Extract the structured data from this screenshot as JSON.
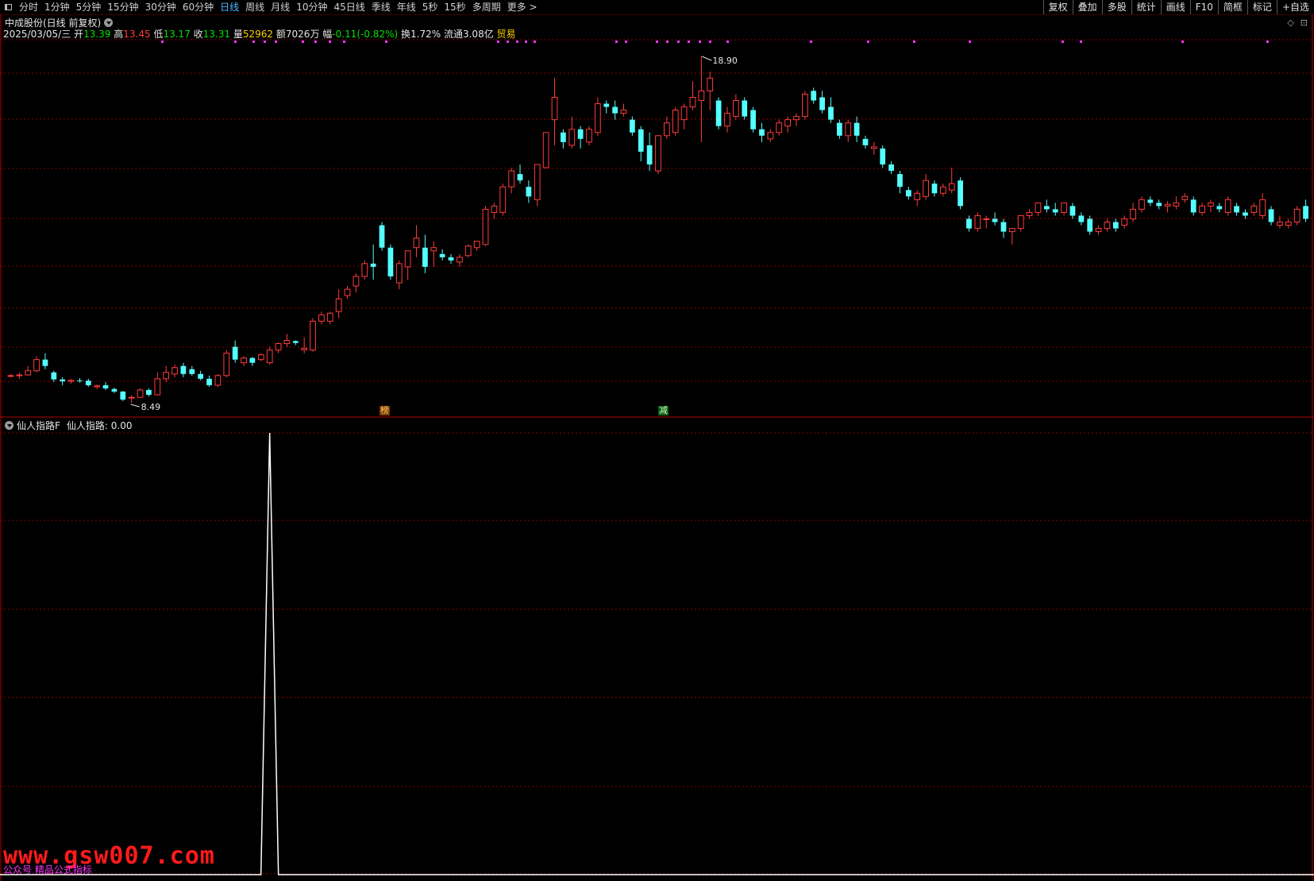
{
  "toolbar": {
    "tabs": [
      "分时",
      "1分钟",
      "5分钟",
      "15分钟",
      "30分钟",
      "60分钟",
      "日线",
      "周线",
      "月线",
      "10分钟",
      "45日线",
      "季线",
      "年线",
      "5秒",
      "15秒",
      "多周期",
      "更多 >"
    ],
    "active_tab": "日线",
    "right_tools": [
      "复权",
      "叠加",
      "多股",
      "统计",
      "画线",
      "F10",
      "简框",
      "标记",
      "+自选"
    ]
  },
  "header": {
    "title": "中成股份(日线 前复权)"
  },
  "quote": {
    "date": "2025/03/05/三",
    "open_label": "开",
    "open": "13.39",
    "high_label": "高",
    "high": "13.45",
    "low_label": "低",
    "low": "13.17",
    "close_label": "收",
    "close": "13.31",
    "vol_label": "量",
    "vol": "52962",
    "amt_label": "额",
    "amt": "7026万",
    "chg_label": "幅",
    "chg": "-0.11(-0.82%)",
    "turn_label": "换",
    "turn": "1.72%",
    "float_label": "流通",
    "float": "3.08亿",
    "sector": "贸易"
  },
  "colors": {
    "up": "#ff3b3b",
    "down": "#54ffff",
    "grid": "#8a0000",
    "marker": "#ff33ff",
    "accent": "#4db8ff"
  },
  "annotations": {
    "high_label": "18.90",
    "low_label": "8.49",
    "badge_1": "榜",
    "badge_2": "减"
  },
  "indicator": {
    "title": "仙人指路F",
    "value_label": "仙人指路: 0.00"
  },
  "watermark": {
    "text": "www.gsw007.com",
    "sub": "公众号 精品公式指标"
  },
  "chart_data": {
    "type": "candlestick",
    "ylim": [
      8.1,
      19.4
    ],
    "candles": [
      [
        8.9,
        8.95,
        8.85,
        8.9
      ],
      [
        8.9,
        9.0,
        8.8,
        8.92
      ],
      [
        8.92,
        9.2,
        8.9,
        9.05
      ],
      [
        9.05,
        9.5,
        9.0,
        9.4
      ],
      [
        9.4,
        9.6,
        9.1,
        9.2
      ],
      [
        9.0,
        9.05,
        8.7,
        8.78
      ],
      [
        8.78,
        8.85,
        8.6,
        8.72
      ],
      [
        8.72,
        8.8,
        8.65,
        8.75
      ],
      [
        8.75,
        8.82,
        8.68,
        8.74
      ],
      [
        8.74,
        8.8,
        8.55,
        8.6
      ],
      [
        8.55,
        8.62,
        8.48,
        8.58
      ],
      [
        8.6,
        8.7,
        8.45,
        8.5
      ],
      [
        8.48,
        8.52,
        8.35,
        8.4
      ],
      [
        8.4,
        8.42,
        8.1,
        8.15
      ],
      [
        8.2,
        8.28,
        8.05,
        8.22
      ],
      [
        8.22,
        8.5,
        8.2,
        8.45
      ],
      [
        8.45,
        8.5,
        8.25,
        8.3
      ],
      [
        8.3,
        9.0,
        8.28,
        8.8
      ],
      [
        8.8,
        9.2,
        8.7,
        9.0
      ],
      [
        8.95,
        9.25,
        8.85,
        9.15
      ],
      [
        9.2,
        9.3,
        8.85,
        8.95
      ],
      [
        9.1,
        9.2,
        8.9,
        8.95
      ],
      [
        8.95,
        9.05,
        8.75,
        8.8
      ],
      [
        8.8,
        8.9,
        8.55,
        8.6
      ],
      [
        8.6,
        8.95,
        8.55,
        8.9
      ],
      [
        8.9,
        9.7,
        8.85,
        9.6
      ],
      [
        9.8,
        10.0,
        9.3,
        9.4
      ],
      [
        9.3,
        9.5,
        9.2,
        9.45
      ],
      [
        9.45,
        9.48,
        9.2,
        9.3
      ],
      [
        9.4,
        9.6,
        9.35,
        9.55
      ],
      [
        9.3,
        9.8,
        9.25,
        9.7
      ],
      [
        9.7,
        9.95,
        9.6,
        9.9
      ],
      [
        9.9,
        10.2,
        9.8,
        10.0
      ],
      [
        9.98,
        10.0,
        9.85,
        9.92
      ],
      [
        9.7,
        10.1,
        9.6,
        9.75
      ],
      [
        9.7,
        10.7,
        9.65,
        10.6
      ],
      [
        10.6,
        10.9,
        10.5,
        10.8
      ],
      [
        10.6,
        10.9,
        10.5,
        10.85
      ],
      [
        10.9,
        11.6,
        10.7,
        11.3
      ],
      [
        11.4,
        11.7,
        11.3,
        11.6
      ],
      [
        11.7,
        12.1,
        11.5,
        12.0
      ],
      [
        12.0,
        12.5,
        11.9,
        12.4
      ],
      [
        12.4,
        13.0,
        11.9,
        12.3
      ],
      [
        13.6,
        13.7,
        12.8,
        12.9
      ],
      [
        12.9,
        13.0,
        11.9,
        12.0
      ],
      [
        11.8,
        12.5,
        11.6,
        12.4
      ],
      [
        12.3,
        12.8,
        11.9,
        12.8
      ],
      [
        12.9,
        13.6,
        12.6,
        13.2
      ],
      [
        12.9,
        13.3,
        12.1,
        12.3
      ],
      [
        12.8,
        13.1,
        12.3,
        12.9
      ],
      [
        12.7,
        12.85,
        12.5,
        12.6
      ],
      [
        12.6,
        12.7,
        12.4,
        12.5
      ],
      [
        12.45,
        12.7,
        12.3,
        12.6
      ],
      [
        12.65,
        13.0,
        12.6,
        12.95
      ],
      [
        12.9,
        13.1,
        12.8,
        13.1
      ],
      [
        13.0,
        14.2,
        12.95,
        14.1
      ],
      [
        14.0,
        14.3,
        13.8,
        14.2
      ],
      [
        14.0,
        14.9,
        13.9,
        14.8
      ],
      [
        14.8,
        15.4,
        14.6,
        15.3
      ],
      [
        15.2,
        15.5,
        14.9,
        15.0
      ],
      [
        14.8,
        15.0,
        14.3,
        14.5
      ],
      [
        14.4,
        15.5,
        14.2,
        15.5
      ],
      [
        15.4,
        16.5,
        15.4,
        16.5
      ],
      [
        16.9,
        18.2,
        16.1,
        17.6
      ],
      [
        16.5,
        16.6,
        16.0,
        16.2
      ],
      [
        16.1,
        17.0,
        16.0,
        16.6
      ],
      [
        16.6,
        16.7,
        16.0,
        16.3
      ],
      [
        16.2,
        16.7,
        16.1,
        16.6
      ],
      [
        16.5,
        17.6,
        16.4,
        17.4
      ],
      [
        17.4,
        17.5,
        17.1,
        17.3
      ],
      [
        17.3,
        17.5,
        16.9,
        17.1
      ],
      [
        17.1,
        17.4,
        17.0,
        17.2
      ],
      [
        16.9,
        17.0,
        16.4,
        16.5
      ],
      [
        16.6,
        16.7,
        15.6,
        15.9
      ],
      [
        16.1,
        16.5,
        15.3,
        15.5
      ],
      [
        15.3,
        16.4,
        15.2,
        16.4
      ],
      [
        16.4,
        17.0,
        16.3,
        16.8
      ],
      [
        16.5,
        17.3,
        16.4,
        17.2
      ],
      [
        16.9,
        17.4,
        16.6,
        17.3
      ],
      [
        17.3,
        18.1,
        17.2,
        17.6
      ],
      [
        17.5,
        18.9,
        16.2,
        17.8
      ],
      [
        17.8,
        18.4,
        17.2,
        18.2
      ],
      [
        17.5,
        17.6,
        16.6,
        16.7
      ],
      [
        16.7,
        17.3,
        16.5,
        17.1
      ],
      [
        17.0,
        17.7,
        16.9,
        17.5
      ],
      [
        17.5,
        17.6,
        16.9,
        17.0
      ],
      [
        17.2,
        17.3,
        16.5,
        16.6
      ],
      [
        16.6,
        16.8,
        16.2,
        16.4
      ],
      [
        16.3,
        16.6,
        16.2,
        16.5
      ],
      [
        16.5,
        16.9,
        16.4,
        16.8
      ],
      [
        16.7,
        17.0,
        16.5,
        16.9
      ],
      [
        16.9,
        17.1,
        16.7,
        17.0
      ],
      [
        17.0,
        17.8,
        16.9,
        17.7
      ],
      [
        17.8,
        17.9,
        17.4,
        17.5
      ],
      [
        17.6,
        17.8,
        17.1,
        17.2
      ],
      [
        17.3,
        17.6,
        16.8,
        16.9
      ],
      [
        16.8,
        16.9,
        16.3,
        16.4
      ],
      [
        16.4,
        16.9,
        16.2,
        16.8
      ],
      [
        16.8,
        17.0,
        16.2,
        16.4
      ],
      [
        16.3,
        16.4,
        16.0,
        16.1
      ],
      [
        16.0,
        16.2,
        15.8,
        16.05
      ],
      [
        16.0,
        16.1,
        15.4,
        15.5
      ],
      [
        15.5,
        15.6,
        15.2,
        15.3
      ],
      [
        15.2,
        15.3,
        14.6,
        14.8
      ],
      [
        14.7,
        14.8,
        14.4,
        14.5
      ],
      [
        14.4,
        14.7,
        14.2,
        14.6
      ],
      [
        14.5,
        15.2,
        14.4,
        15.0
      ],
      [
        14.9,
        15.0,
        14.5,
        14.6
      ],
      [
        14.6,
        14.9,
        14.5,
        14.8
      ],
      [
        14.7,
        15.4,
        14.6,
        14.9
      ],
      [
        15.0,
        15.1,
        14.1,
        14.2
      ],
      [
        13.8,
        13.9,
        13.4,
        13.5
      ],
      [
        13.5,
        14.0,
        13.4,
        13.9
      ],
      [
        13.8,
        13.9,
        13.5,
        13.8
      ],
      [
        13.8,
        14.0,
        13.6,
        13.7
      ],
      [
        13.7,
        13.8,
        13.2,
        13.4
      ],
      [
        13.4,
        13.5,
        13.0,
        13.5
      ],
      [
        13.5,
        13.9,
        13.4,
        13.9
      ],
      [
        13.9,
        14.1,
        13.8,
        14.0
      ],
      [
        14.0,
        14.3,
        13.9,
        14.3
      ],
      [
        14.2,
        14.4,
        14.0,
        14.1
      ],
      [
        14.1,
        14.3,
        13.9,
        14.0
      ],
      [
        14.0,
        14.3,
        13.9,
        14.3
      ],
      [
        14.2,
        14.3,
        13.8,
        13.9
      ],
      [
        13.9,
        14.0,
        13.6,
        13.7
      ],
      [
        13.8,
        13.9,
        13.3,
        13.4
      ],
      [
        13.4,
        13.6,
        13.3,
        13.5
      ],
      [
        13.5,
        13.8,
        13.4,
        13.7
      ],
      [
        13.7,
        13.8,
        13.4,
        13.5
      ],
      [
        13.6,
        13.9,
        13.5,
        13.8
      ],
      [
        13.8,
        14.3,
        13.7,
        14.1
      ],
      [
        14.1,
        14.5,
        14.0,
        14.4
      ],
      [
        14.4,
        14.5,
        14.2,
        14.3
      ],
      [
        14.3,
        14.4,
        14.1,
        14.2
      ],
      [
        14.2,
        14.35,
        14.0,
        14.25
      ],
      [
        14.2,
        14.5,
        14.1,
        14.3
      ],
      [
        14.4,
        14.6,
        14.3,
        14.5
      ],
      [
        14.4,
        14.5,
        13.9,
        14.0
      ],
      [
        14.0,
        14.3,
        13.9,
        14.2
      ],
      [
        14.2,
        14.4,
        14.0,
        14.3
      ],
      [
        14.2,
        14.3,
        14.0,
        14.1
      ],
      [
        14.0,
        14.5,
        13.9,
        14.4
      ],
      [
        14.2,
        14.3,
        13.9,
        14.0
      ],
      [
        14.0,
        14.1,
        13.8,
        13.9
      ],
      [
        14.0,
        14.3,
        13.9,
        14.2
      ],
      [
        13.9,
        14.6,
        13.8,
        14.4
      ],
      [
        14.1,
        14.2,
        13.6,
        13.7
      ],
      [
        13.6,
        13.9,
        13.5,
        13.7
      ],
      [
        13.6,
        13.8,
        13.5,
        13.7
      ],
      [
        13.7,
        14.2,
        13.6,
        14.1
      ],
      [
        14.2,
        14.4,
        13.7,
        13.8
      ]
    ],
    "indicator_series_peak_index": 30,
    "indicator_values_note": "single spike to max at one bar, zero elsewhere"
  }
}
